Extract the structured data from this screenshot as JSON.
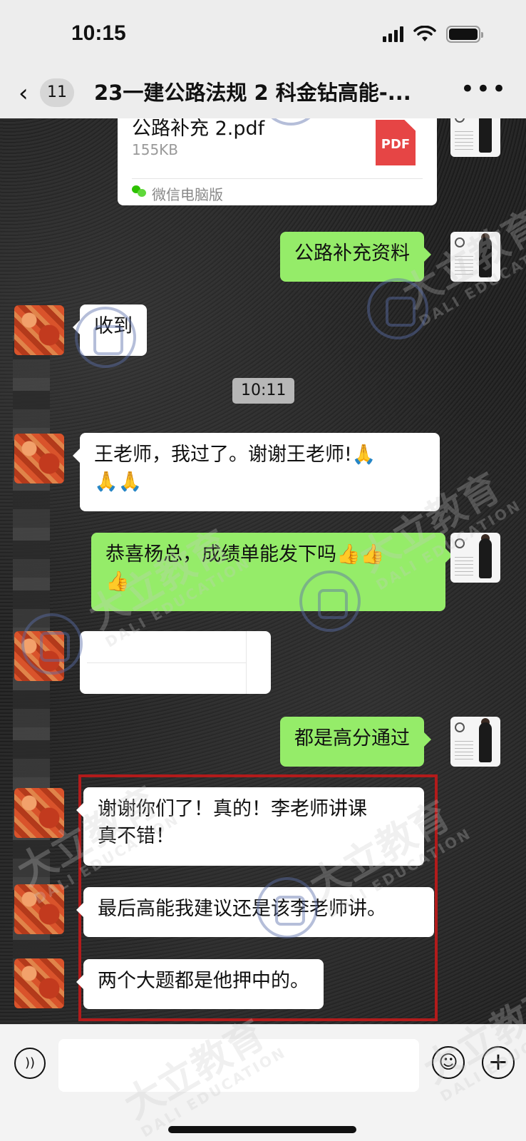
{
  "status_bar": {
    "time": "10:15"
  },
  "nav": {
    "back_badge": "11",
    "title": "23一建公路法规 2 科金钻高能-..."
  },
  "file_card": {
    "name": "公路补充 2.pdf",
    "size": "155KB",
    "pdf_label": "PDF",
    "source": "微信电脑版"
  },
  "messages": {
    "m1": "公路补充资料",
    "m2": "收到",
    "timestamp": "10:11",
    "m3_line1": "王老师，我过了。谢谢王老师!🙏",
    "m3_line2": "🙏🙏",
    "m4_line1": "恭喜杨总，成绩单能发下吗👍👍",
    "m4_line2": "👍",
    "m5": "都是高分通过",
    "m6_line1": "谢谢你们了！真的！李老师讲课",
    "m6_line2": "真不错！",
    "m7": "最后高能我建议还是该李老师讲。",
    "m8": "两个大题都是他押中的。"
  },
  "watermark": {
    "brand": "大立教育",
    "brand_en": "DALI EDUCATION",
    "avatar_brand": "大立教育"
  },
  "colors": {
    "outgoing_bubble": "#95ec69",
    "incoming_bubble": "#ffffff",
    "highlight_border": "#b21b1b",
    "pdf_red": "#e64545"
  },
  "icons": {
    "back": "chevron-left-icon",
    "more": "more-dots-icon",
    "voice": "voice-icon",
    "emoji": "emoji-icon",
    "plus": "plus-icon"
  }
}
